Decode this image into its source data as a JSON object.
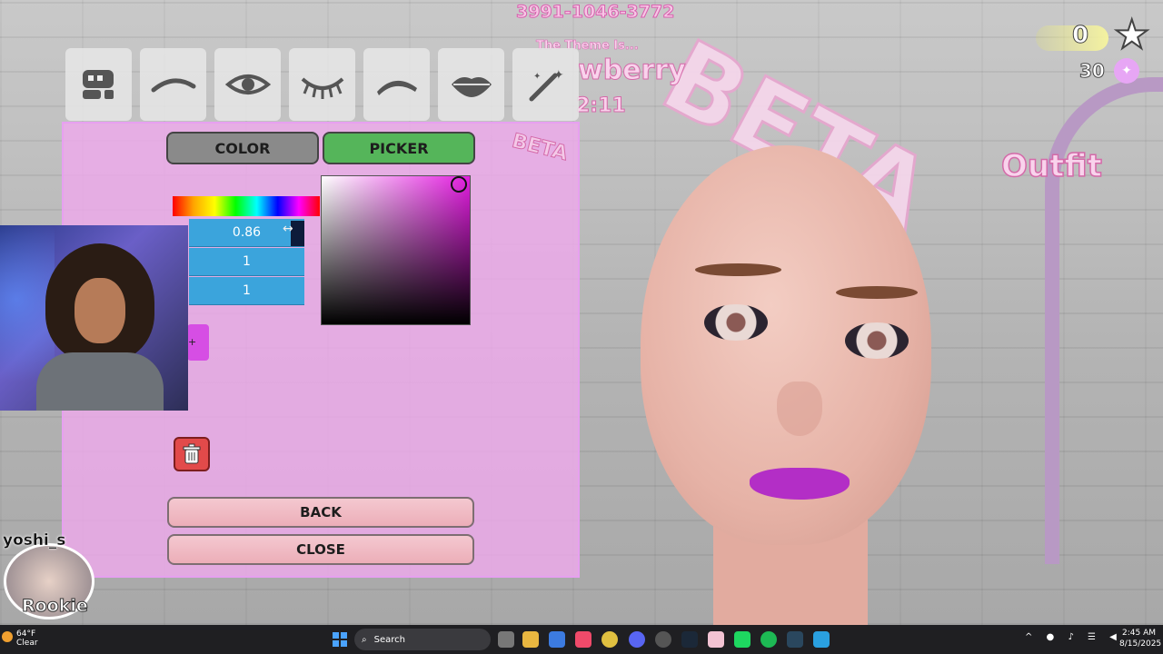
{
  "window_title": "",
  "hud": {
    "room_code": "3991-1046-3772",
    "theme_label": "The Theme Is...",
    "theme_value": "wberry",
    "timer": "2:11",
    "beta_big": "BETA",
    "beta_small": "BETA",
    "outfit_label": "Outfit",
    "stars": "0",
    "xp": "30"
  },
  "tabs": [
    {
      "name": "makeup-kit-tab",
      "icon": "makeup-kit-icon"
    },
    {
      "name": "brow-shape-tab",
      "icon": "eyebrow-icon"
    },
    {
      "name": "eye-tab",
      "icon": "eye-icon"
    },
    {
      "name": "lashes-tab",
      "icon": "eyelashes-icon"
    },
    {
      "name": "brow-tab",
      "icon": "brow-arch-icon"
    },
    {
      "name": "lips-tab",
      "icon": "lips-icon"
    },
    {
      "name": "magic-wand-tab",
      "icon": "magic-wand-icon"
    }
  ],
  "panel": {
    "color_button": "COLOR",
    "picker_button": "PICKER",
    "hsv": {
      "h": "0.86",
      "s": "1",
      "v": "1"
    },
    "selected_color": "#e31ee0",
    "back_button": "BACK",
    "close_button": "CLOSE"
  },
  "player": {
    "name": "yoshi_s",
    "rank": "Rookie"
  },
  "taskbar": {
    "temperature": "64°F",
    "condition": "Clear",
    "search_placeholder": "Search",
    "time": "2:45 AM",
    "date": "8/15/2025"
  }
}
